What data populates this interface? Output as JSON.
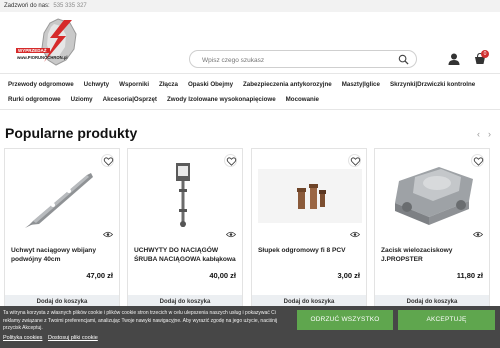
{
  "topbar": {
    "call_label": "Zadzwoń do nas:",
    "phone": "535 335 327"
  },
  "logo": {
    "banner_text": "WYPRZEDAŻ",
    "brand_text": "www.PIORUNOCHRON.pl"
  },
  "search": {
    "placeholder": "Wpisz czego szukasz"
  },
  "header_icons": {
    "account": "user-icon",
    "cart": "cart-icon",
    "cart_count": "0"
  },
  "nav": {
    "row1": [
      "Przewody odgromowe",
      "Uchwyty",
      "Wsporniki",
      "Złącza",
      "Opaski Obejmy",
      "Zabezpieczenia antykorozyjne",
      "Maszty|Iglice",
      "Skrzynki|Drzwiczki kontrolne"
    ],
    "row2": [
      "Rurki odgromowe",
      "Uziomy",
      "Akcesoria|Osprzęt",
      "Zwody Izolowane wysokonapięciowe",
      "Mocowanie"
    ]
  },
  "section": {
    "title": "Popularne produkty"
  },
  "products": [
    {
      "name": "Uchwyt naciągowy wbijany podwójny 40cm",
      "price": "47,00 zł",
      "button": "Dodaj do koszyka"
    },
    {
      "name": "UCHWYTY DO NACIĄGÓW ŚRUBA NACIĄGOWA kabłąkowa",
      "price": "40,00 zł",
      "button": "Dodaj do koszyka"
    },
    {
      "name": "Słupek odgromowy fi 8 PCV",
      "price": "3,00 zł",
      "button": "Dodaj do koszyka"
    },
    {
      "name": "Zacisk wielozaciskowy J.PROPSTER",
      "price": "11,80 zł",
      "button": "Dodaj do koszyka"
    }
  ],
  "cookie": {
    "text": "Ta witryna korzysta z własnych plików cookie i plików cookie stron trzecich w celu ulepszenia naszych usług i pokazywać Ci reklamy związane z Twoimi preferencjami, analizując Twoje nawyki nawigacyjne. Aby wyrazić zgodę na jego użycie, naciśnij przycisk Akceptuj.",
    "link1": "Polityka cookies",
    "link2": "Dostosuj pliki cookie",
    "reject": "ODRZUĆ WSZYSTKO",
    "accept": "AKCEPTUJĘ"
  },
  "colors": {
    "accent_green": "#5fa64e",
    "logo_red": "#d62a2a",
    "cookie_bg": "#3c3c3c"
  }
}
